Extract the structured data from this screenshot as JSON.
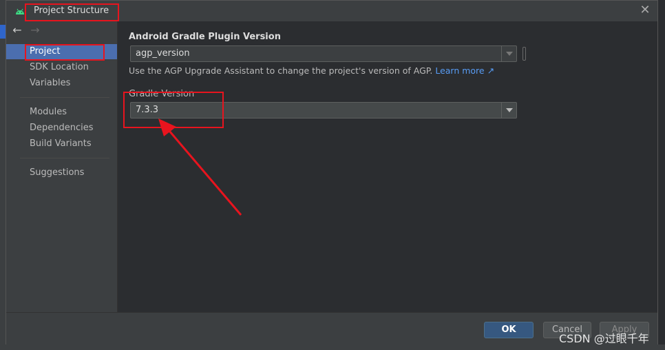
{
  "dialog": {
    "title": "Project Structure",
    "close_icon": "close-icon"
  },
  "sidebar": {
    "items": [
      {
        "label": "Project",
        "selected": true
      },
      {
        "label": "SDK Location",
        "selected": false
      },
      {
        "label": "Variables",
        "selected": false
      },
      {
        "label": "Modules",
        "selected": false
      },
      {
        "label": "Dependencies",
        "selected": false
      },
      {
        "label": "Build Variants",
        "selected": false
      },
      {
        "label": "Suggestions",
        "selected": false
      }
    ]
  },
  "content": {
    "agp_label": "Android Gradle Plugin Version",
    "agp_value": "agp_version",
    "agp_hint": "Use the AGP Upgrade Assistant to change the project's version of AGP.",
    "learn_more": "Learn more ↗",
    "gradle_label": "Gradle Version",
    "gradle_value": "7.3.3"
  },
  "footer": {
    "ok": "OK",
    "cancel": "Cancel",
    "apply": "Apply"
  },
  "watermark": "CSDN @过眼千年",
  "colors": {
    "accent": "#4b6eaf",
    "annotation": "#e8141e",
    "link": "#589df6"
  }
}
